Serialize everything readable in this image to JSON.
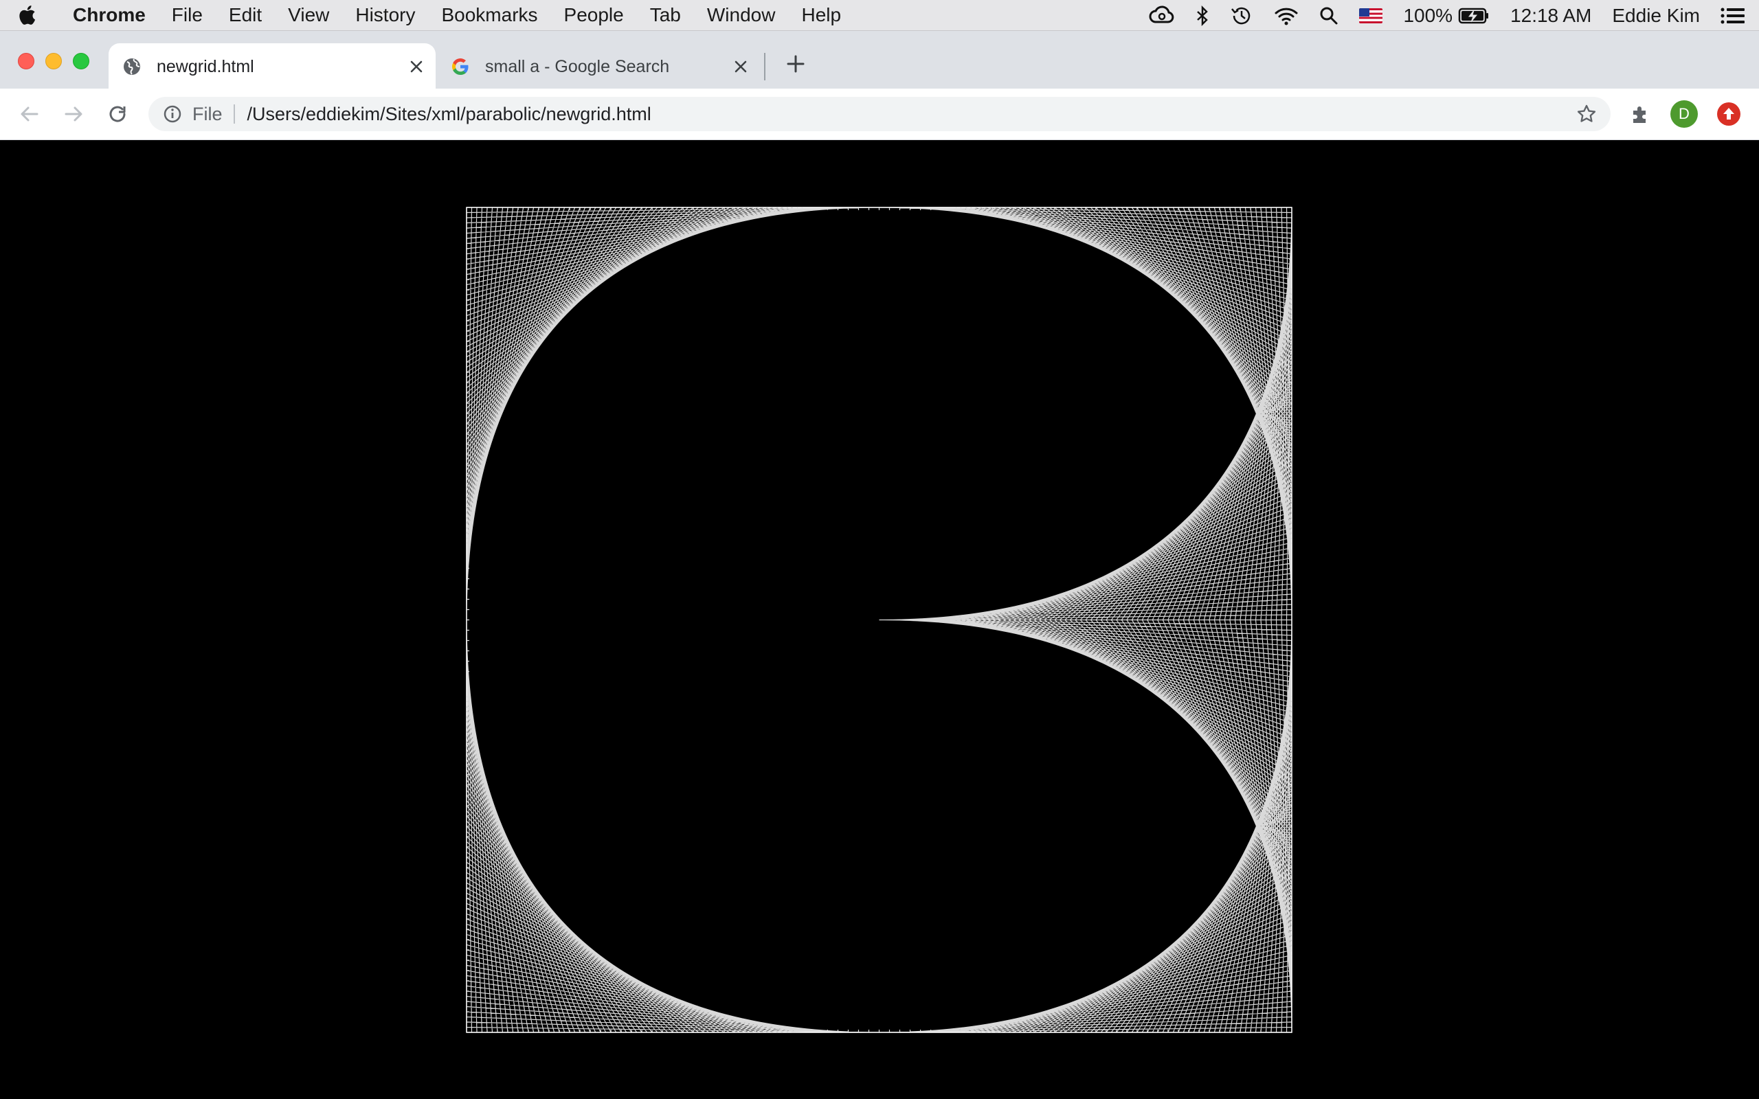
{
  "menubar": {
    "app_name": "Chrome",
    "items": [
      "File",
      "Edit",
      "View",
      "History",
      "Bookmarks",
      "People",
      "Tab",
      "Window",
      "Help"
    ],
    "battery": "100%",
    "time": "12:18 AM",
    "user": "Eddie Kim"
  },
  "tabs": [
    {
      "title": "newgrid.html",
      "active": true,
      "icon": "globe-icon"
    },
    {
      "title": "small a - Google Search",
      "active": false,
      "icon": "google-icon"
    }
  ],
  "omnibox": {
    "scheme_label": "File",
    "url": "/Users/eddiekim/Sites/xml/parabolic/newgrid.html"
  },
  "profile": {
    "initial": "D",
    "color": "#4e9a2e"
  },
  "colors": {
    "page_background": "#000000",
    "line": "#ffffff",
    "update_button": "#d93025"
  },
  "artwork": {
    "description_type": "parabolic line-envelope grid (string art)",
    "border_segments": 80,
    "stroke_color": "#ffffff"
  }
}
